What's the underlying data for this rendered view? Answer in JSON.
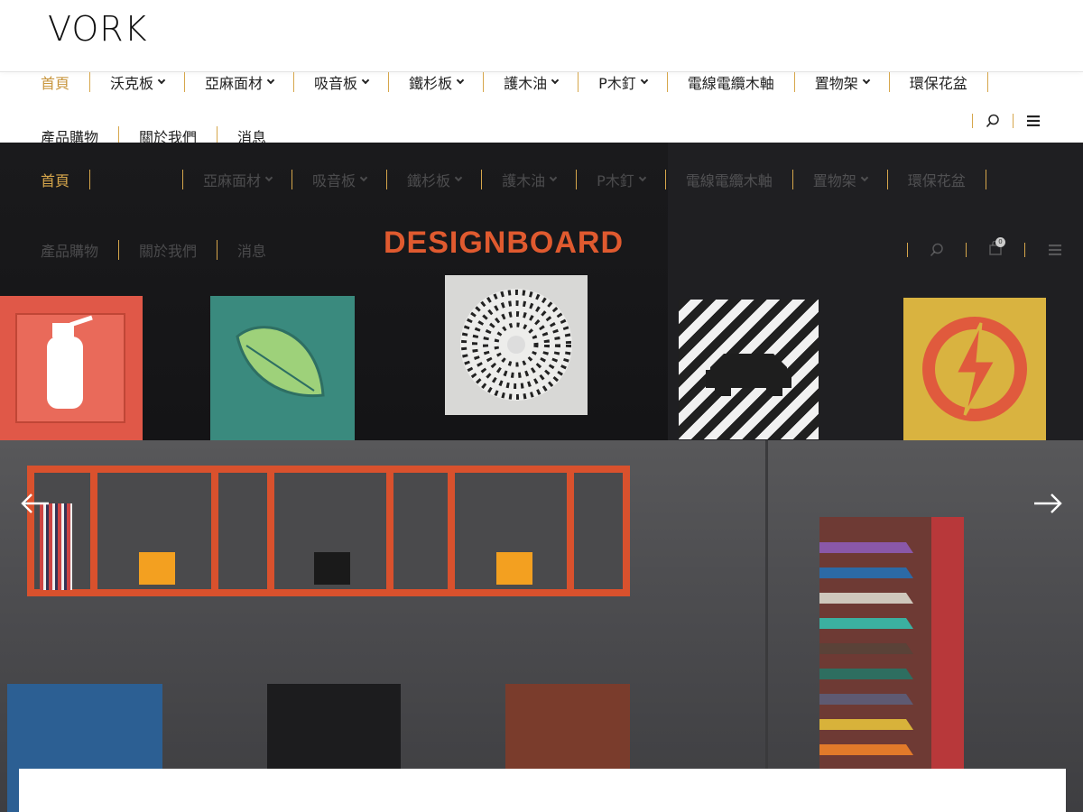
{
  "brand": {
    "logo_text": "VORK"
  },
  "nav": {
    "row1": [
      {
        "label": "首頁",
        "active": true,
        "dropdown": false
      },
      {
        "label": "沃克板",
        "dropdown": true
      },
      {
        "label": "亞麻面材",
        "dropdown": true
      },
      {
        "label": "吸音板",
        "dropdown": true
      },
      {
        "label": "鐵杉板",
        "dropdown": true
      },
      {
        "label": "護木油",
        "dropdown": true
      },
      {
        "label": "P木釘",
        "dropdown": true
      },
      {
        "label": "電線電纜木軸",
        "dropdown": false
      },
      {
        "label": "置物架",
        "dropdown": true
      },
      {
        "label": "環保花盆",
        "dropdown": false
      }
    ],
    "row2": [
      {
        "label": "產品購物"
      },
      {
        "label": "關於我們"
      },
      {
        "label": "消息"
      }
    ]
  },
  "hero": {
    "sign_text": "DESIGNBOARD",
    "cart_count": "0"
  },
  "icons": {
    "search": "search-icon",
    "menu": "hamburger-menu-icon",
    "cart": "shopping-bag-icon",
    "prev": "arrow-left-icon",
    "next": "arrow-right-icon"
  },
  "colors": {
    "accent": "#c8963e",
    "divider": "#d6a64b"
  }
}
